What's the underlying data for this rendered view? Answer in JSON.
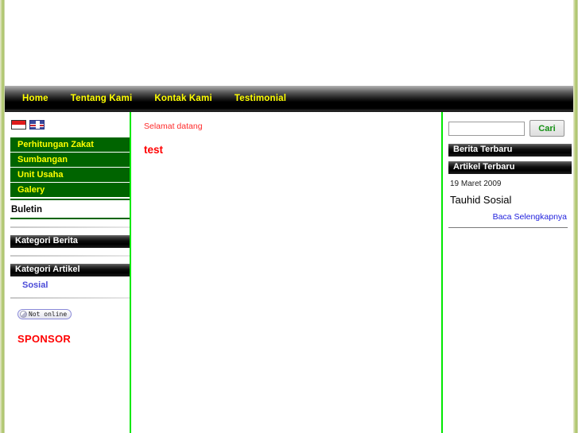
{
  "site": {
    "lang_flags": [
      {
        "name": "indonesia-flag",
        "label": "Bahasa Indonesia"
      },
      {
        "name": "uk-flag",
        "label": "English"
      }
    ]
  },
  "nav": {
    "items": [
      {
        "label": "Home"
      },
      {
        "label": "Tentang Kami"
      },
      {
        "label": "Kontak Kami"
      },
      {
        "label": "Testimonial"
      }
    ]
  },
  "sidebar_left": {
    "green_menu": [
      {
        "label": "Perhitungan Zakat"
      },
      {
        "label": "Sumbangan"
      },
      {
        "label": "Unit Usaha"
      },
      {
        "label": "Galery"
      }
    ],
    "buletin_label": "Buletin",
    "kategori_berita_title": "Kategori Berita",
    "kategori_artikel_title": "Kategori Artikel",
    "kategori_artikel_items": [
      {
        "label": "Sosial"
      }
    ],
    "status_badge": {
      "label": "Not online",
      "icon": "status-circle-icon"
    },
    "sponsor_label": "SPONSOR"
  },
  "main": {
    "welcome_text": "Selamat datang",
    "page_title": "test"
  },
  "sidebar_right": {
    "search": {
      "value": "",
      "placeholder": "",
      "button_label": "Cari"
    },
    "berita_terbaru_title": "Berita Terbaru",
    "artikel_terbaru_title": "Artikel Terbaru",
    "latest_article": {
      "date": "19 Maret 2009",
      "title": "Tauhid Sosial",
      "more_label": "Baca Selengkapnya"
    }
  },
  "colors": {
    "nav_text": "#ffff00",
    "menu_bg": "#006400",
    "menu_text": "#ffff00",
    "divider_green": "#00e800",
    "accent_red": "#ff0000",
    "link_blue": "#2222dd",
    "edge_olive": "#a8c263"
  }
}
